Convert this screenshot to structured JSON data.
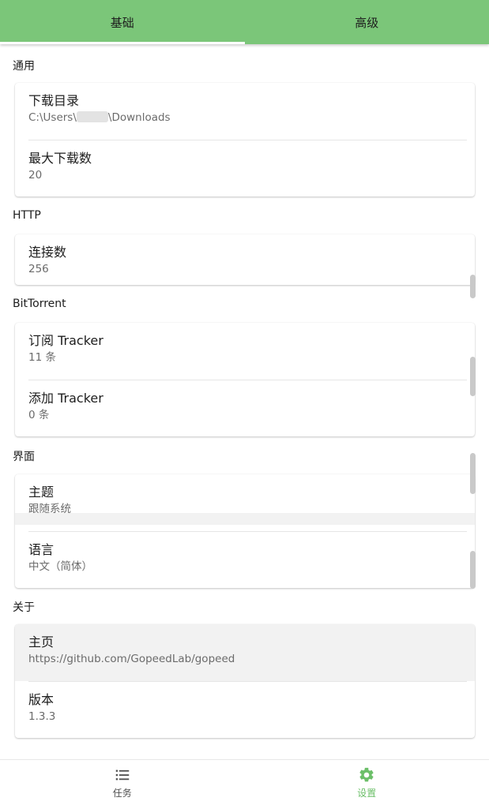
{
  "tabs": [
    {
      "label": "基础",
      "active": true
    },
    {
      "label": "高级",
      "active": false
    }
  ],
  "sections": {
    "general": {
      "title": "通用",
      "items": [
        {
          "title": "下载目录",
          "value_prefix": "C:\\Users\\",
          "value_suffix": "\\Downloads"
        },
        {
          "title": "最大下载数",
          "value": "20"
        }
      ]
    },
    "http": {
      "title": "HTTP",
      "items": [
        {
          "title": "连接数",
          "value": "256"
        }
      ]
    },
    "bittorrent": {
      "title": "BitTorrent",
      "items": [
        {
          "title": "订阅 Tracker",
          "value": "11 条"
        },
        {
          "title": "添加 Tracker",
          "value": "0 条"
        }
      ]
    },
    "ui": {
      "title": "界面",
      "items": [
        {
          "title": "主题",
          "value": "跟随系统"
        },
        {
          "title": "语言",
          "value": "中文（简体）"
        }
      ]
    },
    "about": {
      "title": "关于",
      "items": [
        {
          "title": "主页",
          "value": "https://github.com/GopeedLab/gopeed"
        },
        {
          "title": "版本",
          "value": "1.3.3"
        }
      ]
    }
  },
  "bottom_nav": [
    {
      "label": "任务",
      "icon": "list-icon",
      "active": false
    },
    {
      "label": "设置",
      "icon": "gear-icon",
      "active": true
    }
  ],
  "colors": {
    "primary": "#7bc679",
    "active_nav": "#6cbf69"
  }
}
